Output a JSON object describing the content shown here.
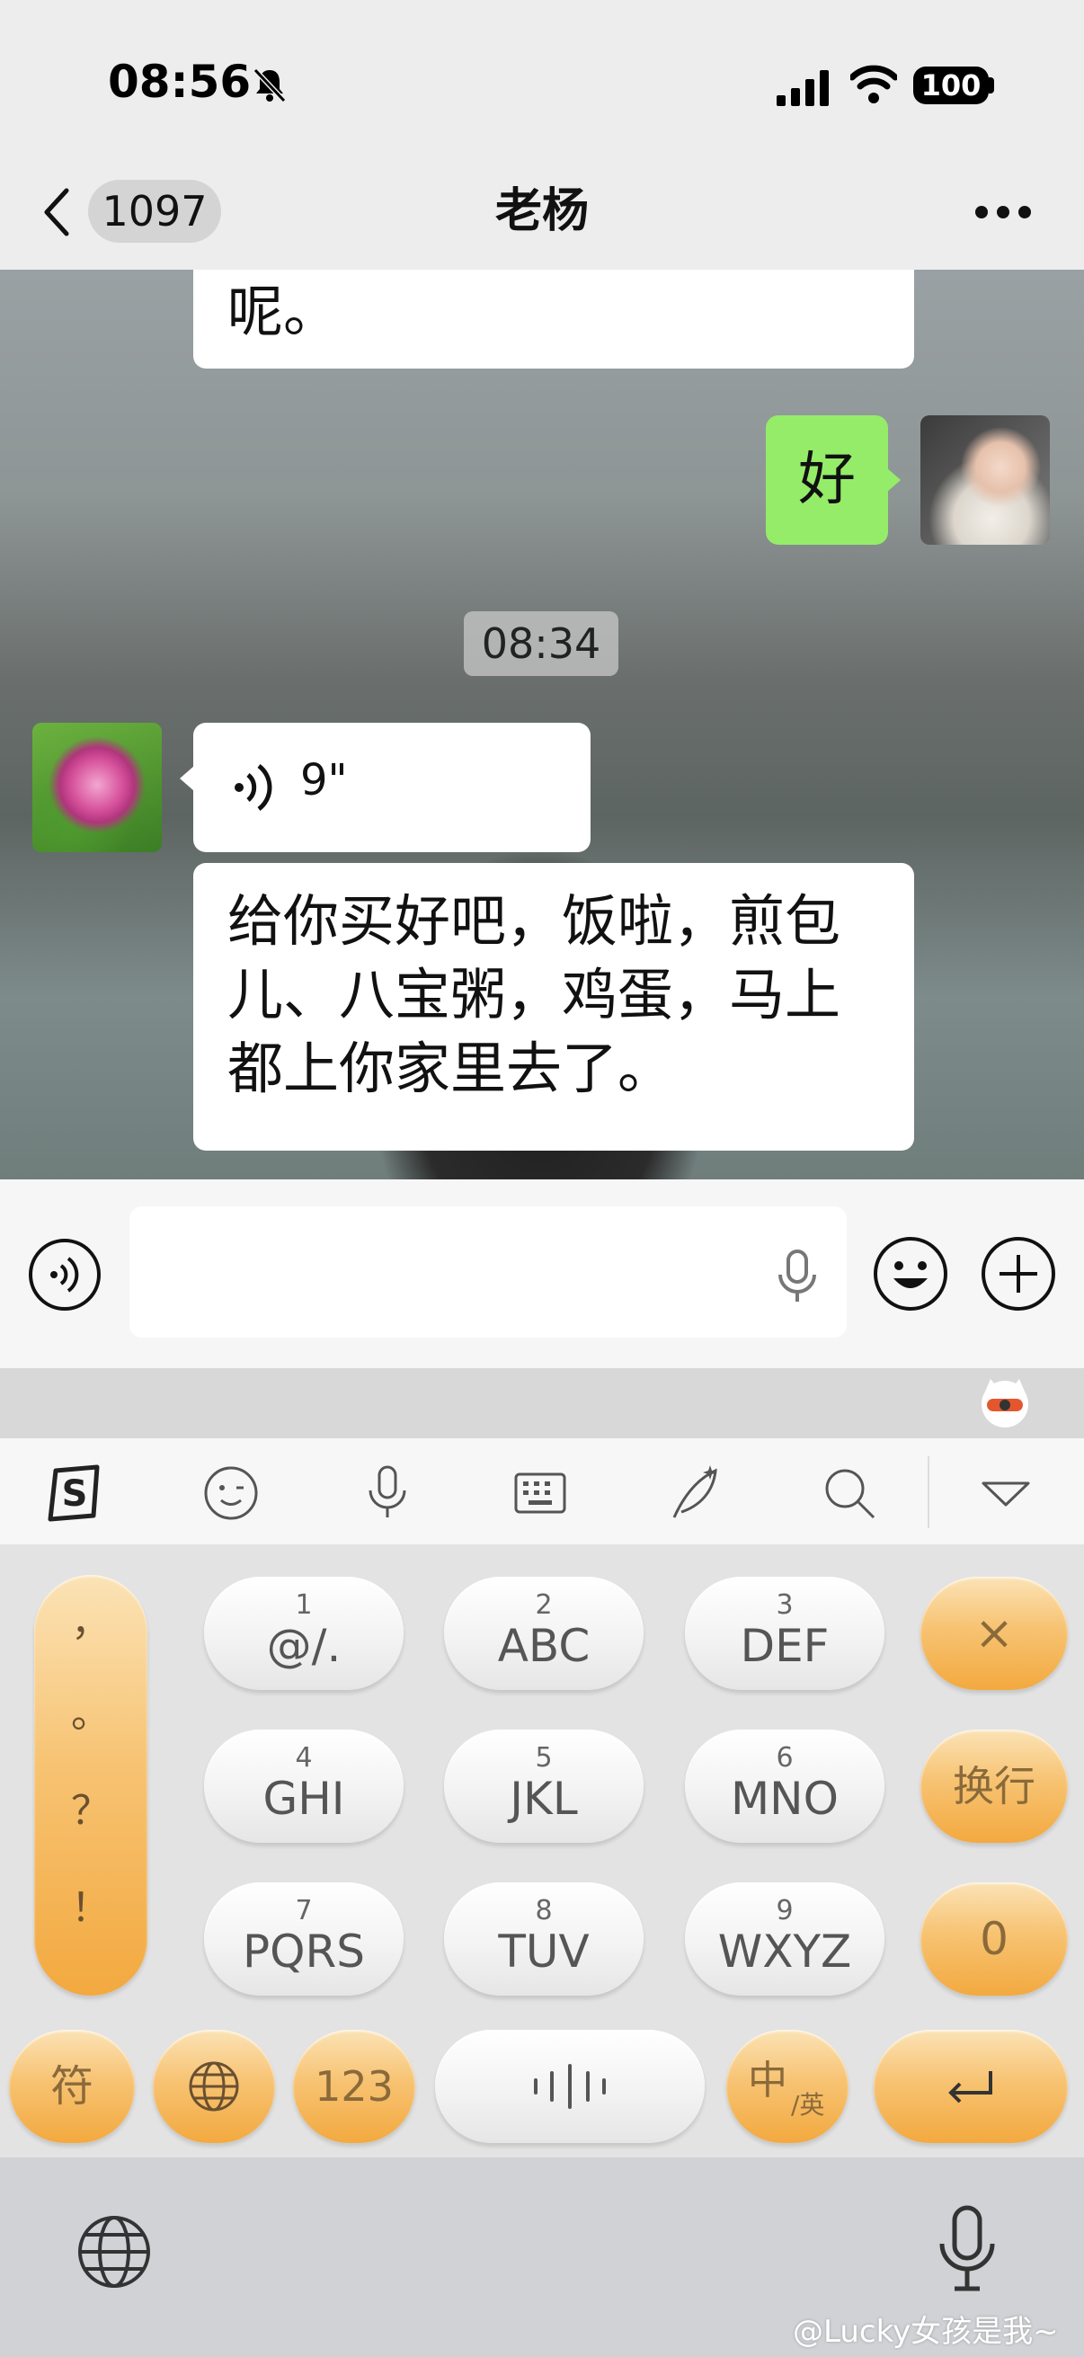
{
  "status_bar": {
    "time": "08:56",
    "battery": "100"
  },
  "nav": {
    "unread_count": "1097",
    "title": "老杨"
  },
  "messages": {
    "partial_incoming": "呢。",
    "outgoing": "好",
    "timestamp": "08:34",
    "voice_duration": "9\"",
    "incoming_text": "给你买好吧，饭啦，煎包儿、八宝粥，鸡蛋，马上都上你家里去了。"
  },
  "input": {
    "placeholder": ""
  },
  "keyboard": {
    "toolbar_icons": [
      "sogou-logo-icon",
      "emoji-face-icon",
      "mic-icon",
      "keyboard-icon",
      "quill-icon",
      "search-icon",
      "collapse-triangle-icon"
    ],
    "punctuation": [
      "，",
      "。",
      "？",
      "！"
    ],
    "keys": [
      {
        "num": "1",
        "letters": "@/."
      },
      {
        "num": "2",
        "letters": "ABC"
      },
      {
        "num": "3",
        "letters": "DEF"
      },
      {
        "num": "4",
        "letters": "GHI"
      },
      {
        "num": "5",
        "letters": "JKL"
      },
      {
        "num": "6",
        "letters": "MNO"
      },
      {
        "num": "7",
        "letters": "PQRS"
      },
      {
        "num": "8",
        "letters": "TUV"
      },
      {
        "num": "9",
        "letters": "WXYZ"
      }
    ],
    "delete_label": "×",
    "newline_label": "换行",
    "zero_label": "0",
    "symbols_label": "符",
    "numbers_label": "123",
    "lang_main": "中",
    "lang_sub": "/英",
    "enter_icon": "return-arrow-icon",
    "accent_color": "#f5b04a"
  },
  "watermark": "@Lucky女孩是我~"
}
